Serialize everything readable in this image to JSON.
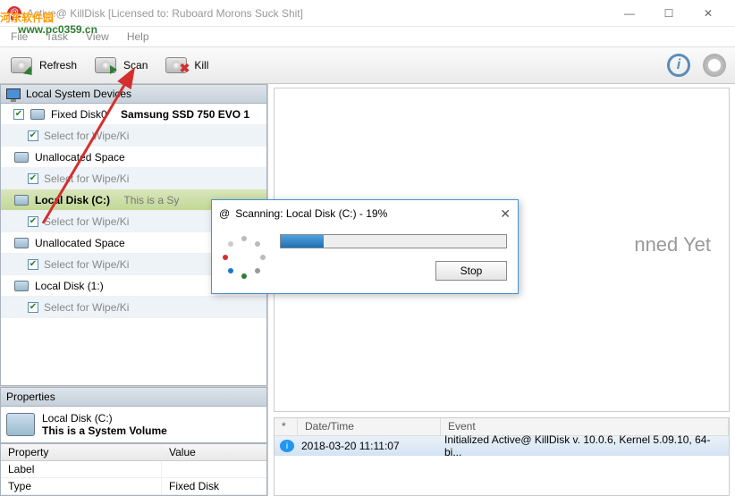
{
  "window": {
    "title": "Active@ KillDisk [Licensed to: Ruboard Morons Suck Shit]",
    "min": "—",
    "max": "☐",
    "close": "✕"
  },
  "menu": {
    "file": "File",
    "task": "Task",
    "view": "View",
    "help": "Help"
  },
  "watermark": {
    "main": "河东软件园",
    "sub": "www.pc0359.cn"
  },
  "toolbar": {
    "refresh": "Refresh",
    "scan": "Scan",
    "kill": "Kill"
  },
  "sidebar": {
    "header": "Local System Devices",
    "items": [
      {
        "label": "Fixed Disk0",
        "bold": "Samsung SSD 750 EVO 1"
      },
      {
        "wipe": "Select for Wipe/Ki"
      },
      {
        "label": "Unallocated Space"
      },
      {
        "wipe": "Select for Wipe/Ki"
      },
      {
        "label": "Local Disk (C:)",
        "sub": "This is a Sy",
        "highlight": true
      },
      {
        "wipe": "Select for Wipe/Ki"
      },
      {
        "label": "Unallocated Space"
      },
      {
        "wipe": "Select for Wipe/Ki"
      },
      {
        "label": "Local Disk (1:)"
      },
      {
        "wipe": "Select for Wipe/Ki"
      }
    ]
  },
  "props": {
    "header": "Properties",
    "name": "Local Disk (C:)",
    "desc": "This is a System Volume",
    "table": {
      "h1": "Property",
      "h2": "Value",
      "rows": [
        {
          "p": "Label",
          "v": ""
        },
        {
          "p": "Type",
          "v": "Fixed Disk"
        }
      ]
    }
  },
  "view": {
    "notscanned": "nned Yet"
  },
  "log": {
    "col0": "*",
    "col1": "Date/Time",
    "col2": "Event",
    "row": {
      "dt": "2018-03-20 11:11:07",
      "ev": "Initialized Active@ KillDisk v. 10.0.6, Kernel 5.09.10, 64-bi..."
    }
  },
  "dialog": {
    "title": "Scanning: Local Disk (C:) - 19%",
    "stop": "Stop",
    "progress": 19
  }
}
